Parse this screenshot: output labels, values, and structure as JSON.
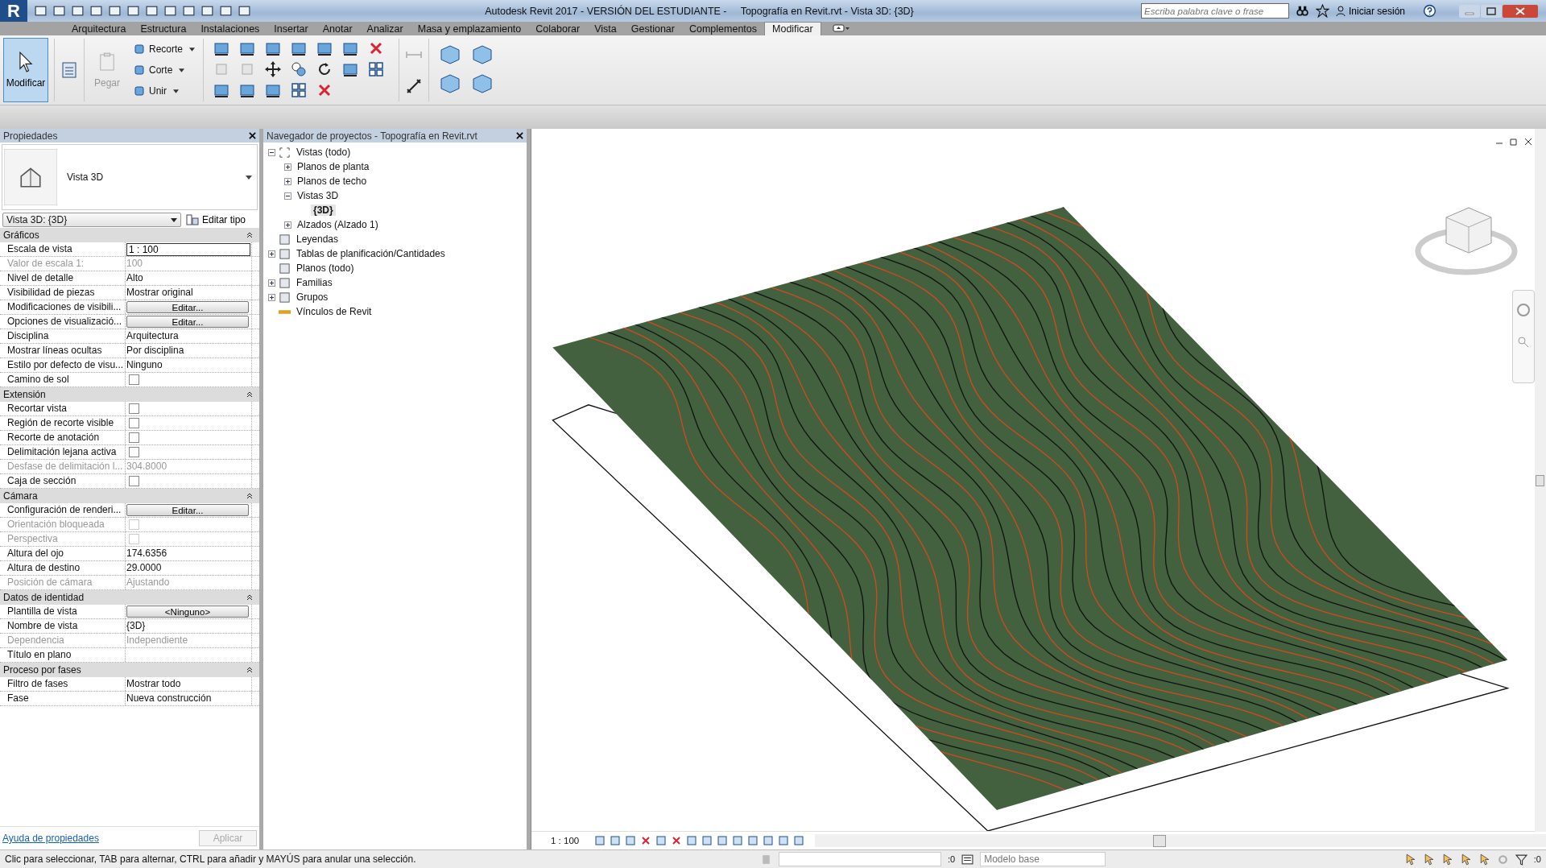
{
  "title_bar": {
    "app_letter": "R",
    "title": "Autodesk Revit 2017 - VERSIÓN DEL ESTUDIANTE -     Topografía en Revit.rvt - Vista 3D: {3D}",
    "search_placeholder": "Escriba palabra clave o frase",
    "sign_in": "Iniciar sesión"
  },
  "ribbon_tabs": [
    {
      "label": "Arquitectura",
      "selected": false
    },
    {
      "label": "Estructura",
      "selected": false
    },
    {
      "label": "Instalaciones",
      "selected": false
    },
    {
      "label": "Insertar",
      "selected": false
    },
    {
      "label": "Anotar",
      "selected": false
    },
    {
      "label": "Analizar",
      "selected": false
    },
    {
      "label": "Masa y emplazamiento",
      "selected": false
    },
    {
      "label": "Colaborar",
      "selected": false
    },
    {
      "label": "Vista",
      "selected": false
    },
    {
      "label": "Gestionar",
      "selected": false
    },
    {
      "label": "Complementos",
      "selected": false
    },
    {
      "label": "Modificar",
      "selected": true
    }
  ],
  "ribbon": {
    "modify_button": {
      "label": "Modificar",
      "selected": true
    },
    "paste_button": {
      "label": "Pegar",
      "disabled": true
    },
    "geometry_buttons": [
      {
        "label": "Recorte",
        "disabled": false
      },
      {
        "label": "Corte",
        "disabled": false
      },
      {
        "label": "Unir",
        "disabled": false
      }
    ]
  },
  "properties": {
    "title": "Propiedades",
    "type_name": "Vista 3D",
    "type_selector": "Vista 3D: {3D}",
    "edit_type": "Editar tipo",
    "groups": [
      {
        "name": "Gráficos",
        "rows": [
          {
            "label": "Escala de vista",
            "kind": "field",
            "value": "1 : 100",
            "disabled": false
          },
          {
            "label": "Valor de escala    1:",
            "kind": "text",
            "value": "100",
            "disabled": true
          },
          {
            "label": "Nivel de detalle",
            "kind": "text",
            "value": "Alto",
            "disabled": false
          },
          {
            "label": "Visibilidad de piezas",
            "kind": "text",
            "value": "Mostrar original",
            "disabled": false
          },
          {
            "label": "Modificaciones de visibili...",
            "kind": "button",
            "value": "Editar...",
            "disabled": false
          },
          {
            "label": "Opciones de visualizació...",
            "kind": "button",
            "value": "Editar...",
            "disabled": false
          },
          {
            "label": "Disciplina",
            "kind": "text",
            "value": "Arquitectura",
            "disabled": false
          },
          {
            "label": "Mostrar líneas ocultas",
            "kind": "text",
            "value": "Por disciplina",
            "disabled": false
          },
          {
            "label": "Estilo por defecto de visu...",
            "kind": "text",
            "value": "Ninguno",
            "disabled": false
          },
          {
            "label": "Camino de sol",
            "kind": "checkbox",
            "checked": false,
            "disabled": false
          }
        ]
      },
      {
        "name": "Extensión",
        "rows": [
          {
            "label": "Recortar vista",
            "kind": "checkbox",
            "checked": false,
            "disabled": false
          },
          {
            "label": "Región de recorte visible",
            "kind": "checkbox",
            "checked": false,
            "disabled": false
          },
          {
            "label": "Recorte de anotación",
            "kind": "checkbox",
            "checked": false,
            "disabled": false
          },
          {
            "label": "Delimitación lejana activa",
            "kind": "checkbox",
            "checked": false,
            "disabled": false
          },
          {
            "label": "Desfase de delimitación l...",
            "kind": "text",
            "value": "304.8000",
            "disabled": true
          },
          {
            "label": "Caja de sección",
            "kind": "checkbox",
            "checked": false,
            "disabled": false
          }
        ]
      },
      {
        "name": "Cámara",
        "rows": [
          {
            "label": "Configuración de renderi...",
            "kind": "button",
            "value": "Editar...",
            "disabled": false
          },
          {
            "label": "Orientación bloqueada",
            "kind": "checkbox",
            "checked": false,
            "disabled": true
          },
          {
            "label": "Perspectiva",
            "kind": "checkbox",
            "checked": false,
            "disabled": true
          },
          {
            "label": "Altura del ojo",
            "kind": "text",
            "value": "174.6356",
            "disabled": false
          },
          {
            "label": "Altura de destino",
            "kind": "text",
            "value": "29.0000",
            "disabled": false
          },
          {
            "label": "Posición de cámara",
            "kind": "text",
            "value": "Ajustando",
            "disabled": true
          }
        ]
      },
      {
        "name": "Datos de identidad",
        "rows": [
          {
            "label": "Plantilla de vista",
            "kind": "button",
            "value": "<Ninguno>",
            "disabled": false
          },
          {
            "label": "Nombre de vista",
            "kind": "text",
            "value": "{3D}",
            "disabled": false
          },
          {
            "label": "Dependencia",
            "kind": "text",
            "value": "Independiente",
            "disabled": true
          },
          {
            "label": "Título en plano",
            "kind": "text",
            "disabled": false
          }
        ]
      },
      {
        "name": "Proceso por fases",
        "rows": [
          {
            "label": "Filtro de fases",
            "kind": "text",
            "value": "Mostrar todo",
            "disabled": false
          },
          {
            "label": "Fase",
            "kind": "text",
            "value": "Nueva construcción",
            "disabled": false
          }
        ]
      }
    ],
    "help_link": "Ayuda de propiedades",
    "apply_button": {
      "label": "Aplicar",
      "disabled": true
    }
  },
  "browser": {
    "title": "Navegador de proyectos - Topografía en Revit.rvt",
    "tree": [
      {
        "label": "Vistas (todo)",
        "kind": "views",
        "expanded": true,
        "selected": false,
        "children": [
          {
            "label": "Planos de planta",
            "expanded": false,
            "selected": false
          },
          {
            "label": "Planos de techo",
            "expanded": false,
            "selected": false
          },
          {
            "label": "Vistas 3D",
            "expanded": true,
            "selected": false,
            "children": [
              {
                "label": "{3D}",
                "selected": true
              }
            ]
          },
          {
            "label": "Alzados (Alzado 1)",
            "expanded": false,
            "selected": false
          }
        ]
      },
      {
        "label": "Leyendas",
        "kind": "legend",
        "selected": false
      },
      {
        "label": "Tablas de planificación/Cantidades",
        "kind": "table",
        "expanded": false,
        "selected": false
      },
      {
        "label": "Planos (todo)",
        "kind": "sheet",
        "selected": false
      },
      {
        "label": "Familias",
        "kind": "family",
        "expanded": false,
        "selected": false
      },
      {
        "label": "Grupos",
        "kind": "group",
        "expanded": false,
        "selected": false
      },
      {
        "label": "Vínculos de Revit",
        "kind": "link",
        "selected": false
      }
    ]
  },
  "view": {
    "scale": "1 : 100"
  },
  "status_bar": {
    "message": "Clic para seleccionar, TAB para alternar, CTRL para añadir y MAYÚS para anular una selección.",
    "selection_count": ":0",
    "model": "Modelo base",
    "filter_count": ":0"
  }
}
